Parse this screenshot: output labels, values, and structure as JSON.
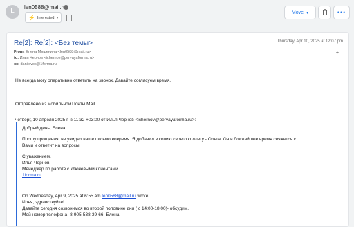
{
  "header": {
    "avatar_letter": "L",
    "sender_email": "len0588@mail.ru",
    "tag": "Interested",
    "actions": {
      "move": "Move",
      "more": "•••"
    }
  },
  "message": {
    "subject": "Re[2]: Re[2]: <Без темы>",
    "date": "Thursday, Apr 10, 2025 at 12:07 pm",
    "from_label": "From:",
    "from_value": "Елена Мишенина <len0588@mail.ru>",
    "to_label": "to:",
    "to_value": "Илья Чернов <ichernov@pervayaforma.ru>",
    "cc_label": "cc:",
    "cc_value": "danilovos@1forma.ru",
    "body": [
      "Не всегда могу оперативно ответить на звонок. Давайте согласуем время.",
      "Отправлено из мобильной Почты Mail"
    ],
    "quote_header": "четверг, 10 апреля 2025 г. в 11:32 +03:00 от Илья Чернов <ichernov@pervayaforma.ru>:",
    "quote_lines": [
      "Добрый день, Елена!",
      "Прошу прощения, не увидел ваше письмо вовремя. Я добавил в копию своего коллегу - Олега. Он в ближайшее время свяжется с",
      "Вами и ответит на вопросы.",
      "С уважением,",
      "Илья Чернов,",
      "Менеджер по работе с ключевыми клиентами",
      "1forma.ru",
      "On Wednesday, Apr 9, 2025 at 6:55 am ",
      "len0588@mail.ru",
      " wrote:",
      "Илья, здравствуйте!",
      "Давайте сегодня созвонимся во второй половине дня ( с 14:00-18:00)- обсудим.",
      "Мой номер телефона- 8-905-538-39-66- Елена."
    ]
  }
}
